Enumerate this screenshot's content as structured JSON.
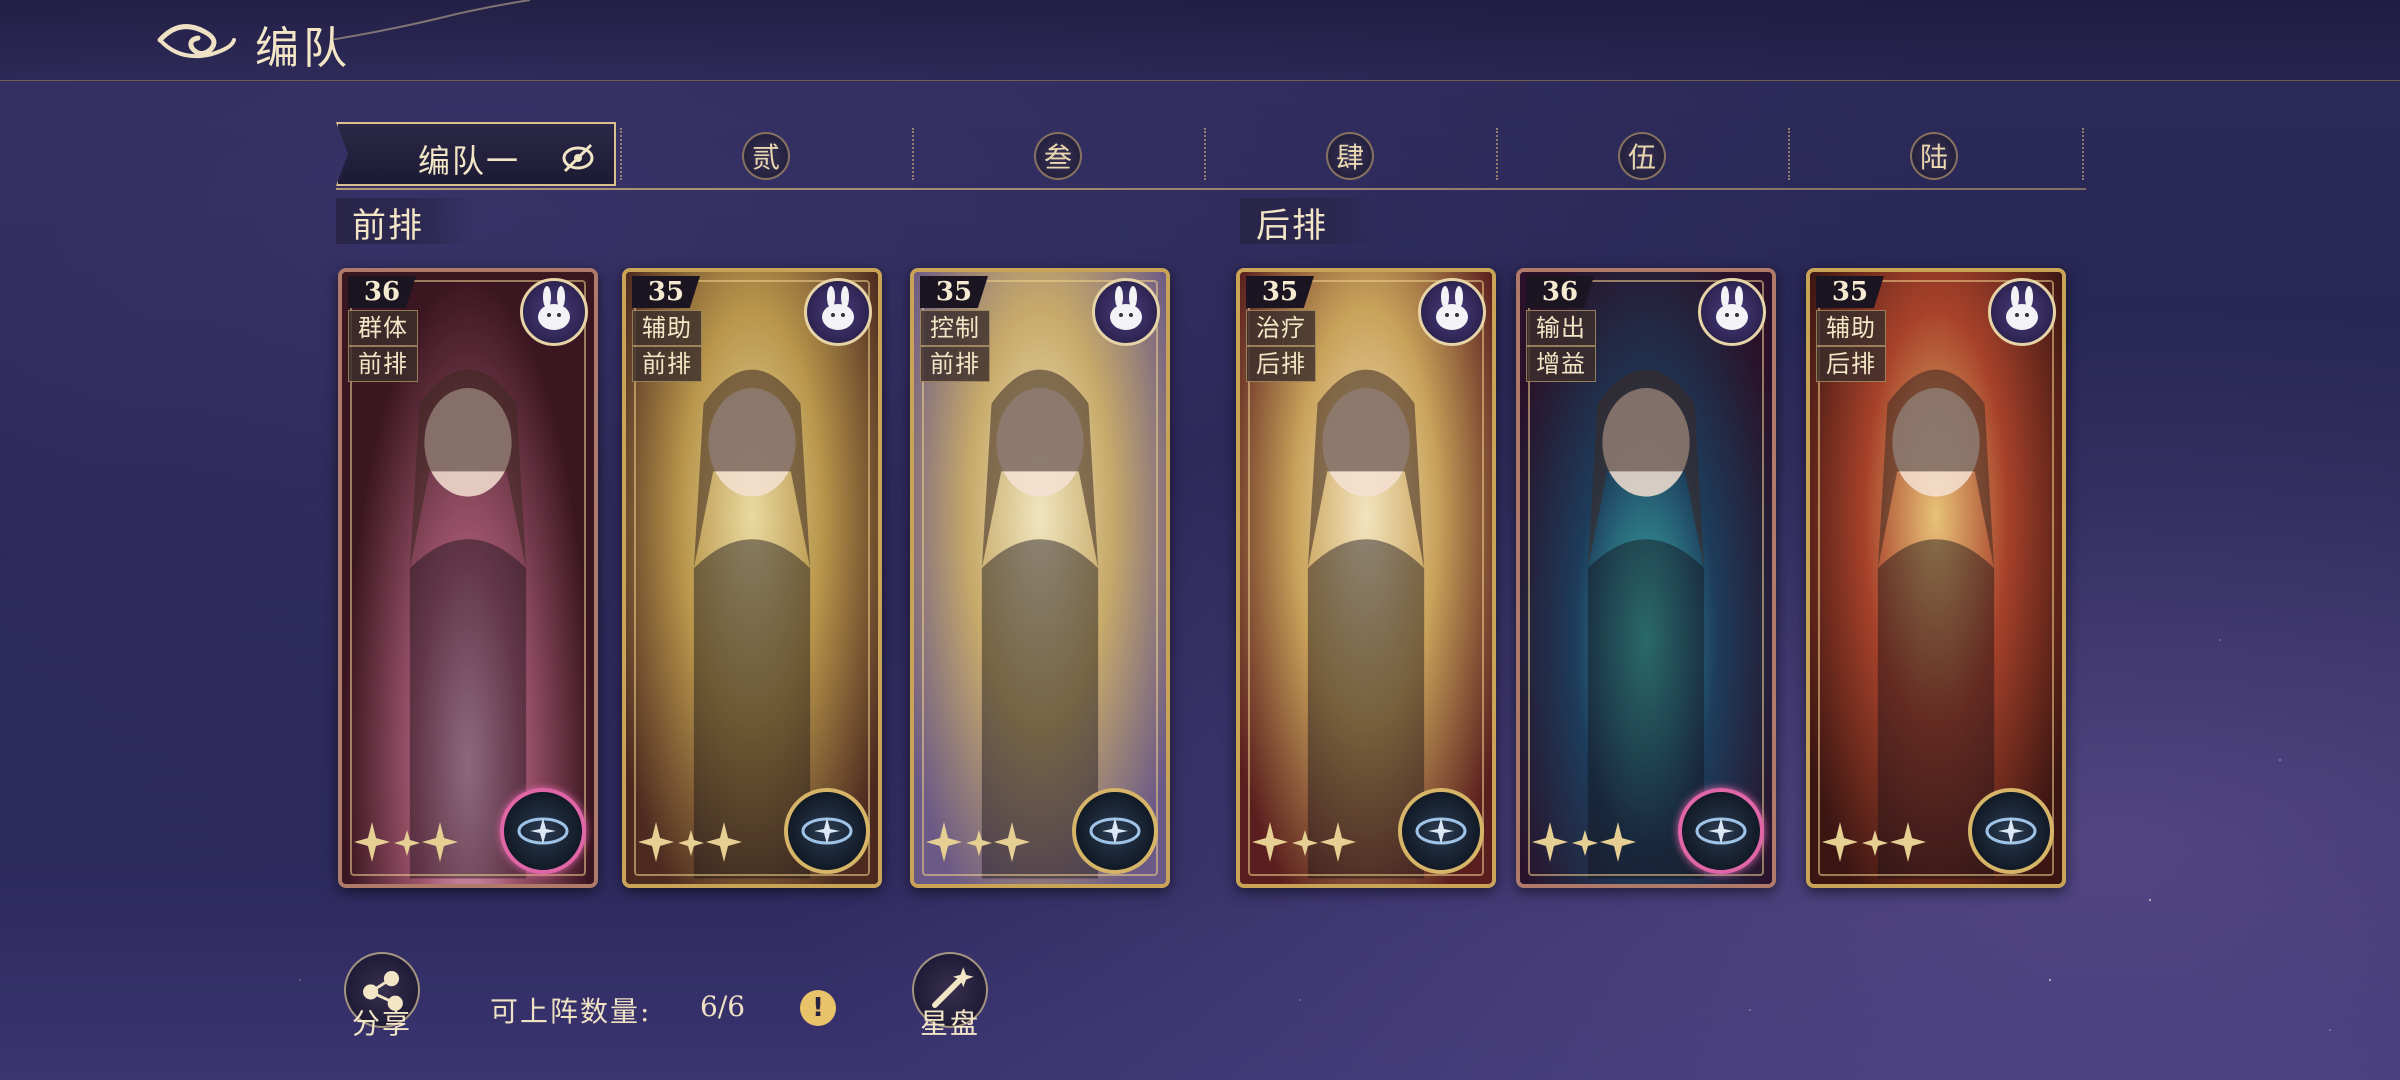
{
  "header": {
    "title": "编队"
  },
  "tabs": {
    "active_label": "编队一",
    "items": [
      "贰",
      "叁",
      "肆",
      "伍",
      "陆"
    ]
  },
  "rows": {
    "front": "前排",
    "back": "后排"
  },
  "cards": [
    {
      "level": "36",
      "tag1": "群体",
      "tag2": "前排",
      "frame": "red"
    },
    {
      "level": "35",
      "tag1": "辅助",
      "tag2": "前排",
      "frame": "gold"
    },
    {
      "level": "35",
      "tag1": "控制",
      "tag2": "前排",
      "frame": "gold"
    },
    {
      "level": "35",
      "tag1": "治疗",
      "tag2": "后排",
      "frame": "gold"
    },
    {
      "level": "36",
      "tag1": "输出",
      "tag2": "增益",
      "frame": "red"
    },
    {
      "level": "35",
      "tag1": "辅助",
      "tag2": "后排",
      "frame": "gold"
    }
  ],
  "footer": {
    "share_label": "分享",
    "count_label": "可上阵数量:",
    "count_value": "6/6",
    "info_icon": "!",
    "star_label": "星盘"
  },
  "colors": {
    "accent_gold": "#caa456",
    "frame_red": "#b07a6a",
    "bg": "#2a2857"
  }
}
